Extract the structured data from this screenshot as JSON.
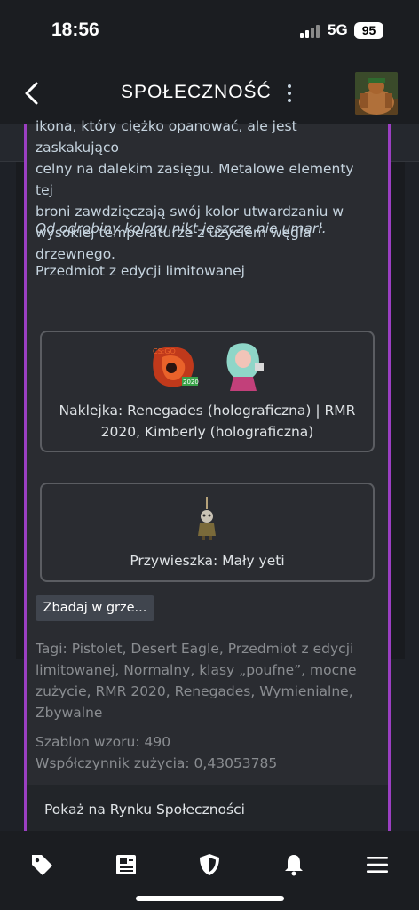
{
  "status_bar": {
    "time": "18:56",
    "network": "5G",
    "battery": "95"
  },
  "header": {
    "title": "SPOŁECZNOŚĆ"
  },
  "item": {
    "description_lines": [
      "ikona, który ciężko opanować, ale jest zaskakująco",
      "celny na dalekim zasięgu. Metalowe elementy tej",
      "broni zawdzięczają swój kolor utwardzaniu w",
      "wysokiej temperaturze z użyciem węgla drzewnego."
    ],
    "quote": "Od odrobiny koloru nikt jeszcze nie umarł.",
    "edition": "Przedmiot z edycji limitowanej",
    "stickers": {
      "label_line1": "Naklejka: Renegades (holograficzna) | RMR",
      "label_line2": "2020, Kimberly (holograficzna)"
    },
    "charm": {
      "label": "Przywieszka: Mały yeti"
    },
    "inspect_button": "Zbadaj w grze...",
    "tags_lines": [
      "Tagi: Pistolet, Desert Eagle, Przedmiot z edycji",
      "limitowanej, Normalny, klasy „poufne”, mocne",
      "zużycie, RMR 2020, Renegades, Wymienialne,",
      "Zbywalne"
    ],
    "pattern": "Szablon wzoru: 490",
    "wear": "Współczynnik zużycia: 0,43053785",
    "market_link": "Pokaż na Rynku Społeczności"
  },
  "bottom_nav": [
    "tag-icon",
    "news-icon",
    "shield-icon",
    "bell-icon",
    "menu-icon"
  ],
  "colors": {
    "accent_border": "#9b3fc2",
    "background": "#1b1d21",
    "panel": "#2a2c31"
  }
}
